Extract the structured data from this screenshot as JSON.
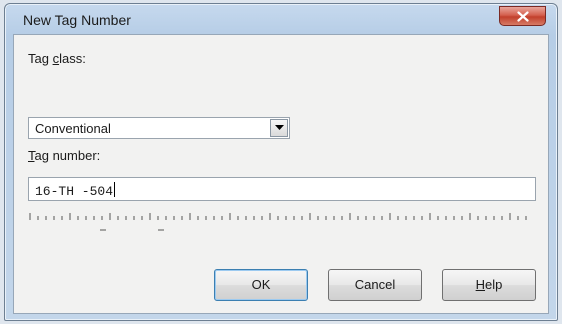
{
  "dialog": {
    "title": "New Tag Number",
    "close_icon": "close-x-icon"
  },
  "tag_class": {
    "label_mnemonic": "Tag ",
    "label_rest_prefix": "c",
    "label_rest": "lass:",
    "selected": "Conventional",
    "dropdown_icon": "chevron-down-icon"
  },
  "tag_number": {
    "label_mnemonic": "T",
    "label_rest": "ag number:",
    "value": "16-TH -504"
  },
  "buttons": {
    "ok": "OK",
    "cancel": "Cancel",
    "help_mnemonic": "H",
    "help_rest": "elp"
  },
  "colors": {
    "title_bar": "#c6d9ee",
    "close_button": "#c2402c",
    "client_bg": "#f2f2f1"
  }
}
